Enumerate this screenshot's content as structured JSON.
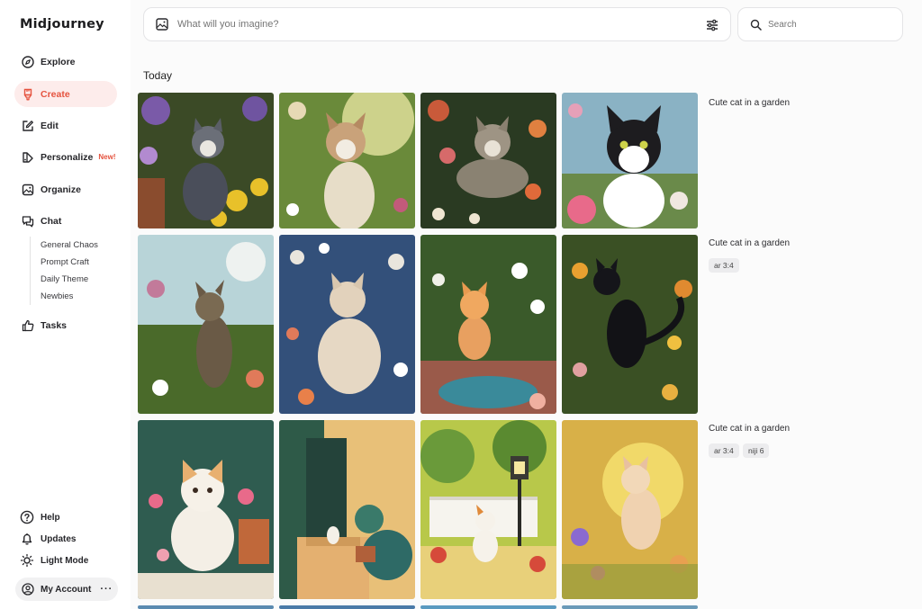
{
  "app": {
    "name": "Midjourney"
  },
  "nav": {
    "explore": "Explore",
    "create": "Create",
    "edit": "Edit",
    "personalize": "Personalize",
    "personalize_badge": "New!",
    "organize": "Organize",
    "chat": "Chat",
    "chat_channels": [
      "General Chaos",
      "Prompt Craft",
      "Daily Theme",
      "Newbies"
    ],
    "tasks": "Tasks"
  },
  "footer": {
    "help": "Help",
    "updates": "Updates",
    "light_mode": "Light Mode",
    "account": "My Account"
  },
  "prompt": {
    "placeholder": "What will you imagine?"
  },
  "search": {
    "placeholder": "Search"
  },
  "feed": {
    "section": "Today",
    "rows": [
      {
        "prompt": "Cute cat in a garden",
        "params": []
      },
      {
        "prompt": "Cute cat in a garden",
        "params": [
          "ar 3:4"
        ]
      },
      {
        "prompt": "Cute cat in a garden",
        "params": [
          "ar 3:4",
          "niji 6"
        ]
      }
    ]
  },
  "colors": {
    "accent": "#e5533f",
    "active_bg": "#fdeceb"
  }
}
